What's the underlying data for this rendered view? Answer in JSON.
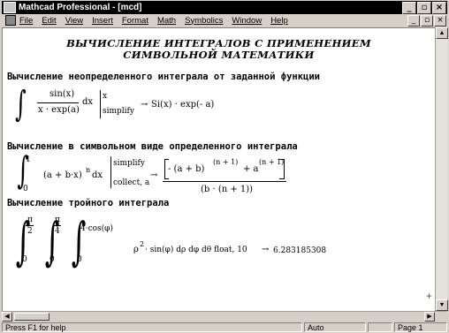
{
  "window": {
    "title": "Mathcad Professional - [mcd]",
    "buttons": {
      "minimize": "_",
      "maximize": "▫",
      "close": "×"
    }
  },
  "menu": {
    "items": [
      "File",
      "Edit",
      "View",
      "Insert",
      "Format",
      "Math",
      "Symbolics",
      "Window",
      "Help"
    ]
  },
  "document": {
    "title_line1": "ВЫЧИСЛЕНИЕ ИНТЕГРАЛОВ С ПРИМЕНЕНИЕМ",
    "title_line2": "СИМВОЛЬНОЙ МАТЕМАТИКИ",
    "section1": {
      "heading": "Вычисление неопределенного интеграла от заданной функции",
      "numerator": "sin(x)",
      "denominator": "x · exp(a)",
      "dx": "dx",
      "op1": "x",
      "op2": "simplify",
      "arrow": "→",
      "result": "Si(x) · exp(- a)"
    },
    "section2": {
      "heading": "Вычисление в символьном виде определенного интеграла",
      "upper": "1",
      "lower": "0",
      "integrand": "(a + b·x)",
      "integrand_exp": "n",
      "dx": "dx",
      "op1": "simplify",
      "op2": "collect, a",
      "arrow": "→",
      "result_num": "- (a + b)",
      "result_num_exp1": "(n + 1)",
      "result_num_plus": "+ a",
      "result_num_exp2": "(n + 1)",
      "result_den": "(b · (n + 1))"
    },
    "section3": {
      "heading": "Вычисление тройного интеграла",
      "upper1": "π",
      "upper1_den": "2",
      "upper2": "π",
      "upper2_den": "4",
      "upper3": "4·cos(φ)",
      "lower1": "0",
      "lower2": "0",
      "lower3": "0",
      "integrand": "ρ",
      "integrand_exp": "2",
      "rest": "· sin(φ) dρ dφ dθ  float, 10",
      "arrow": "→",
      "result": "6.283185308"
    }
  },
  "status": {
    "help": "Press F1 for help",
    "mode": "Auto",
    "page": "Page 1"
  }
}
